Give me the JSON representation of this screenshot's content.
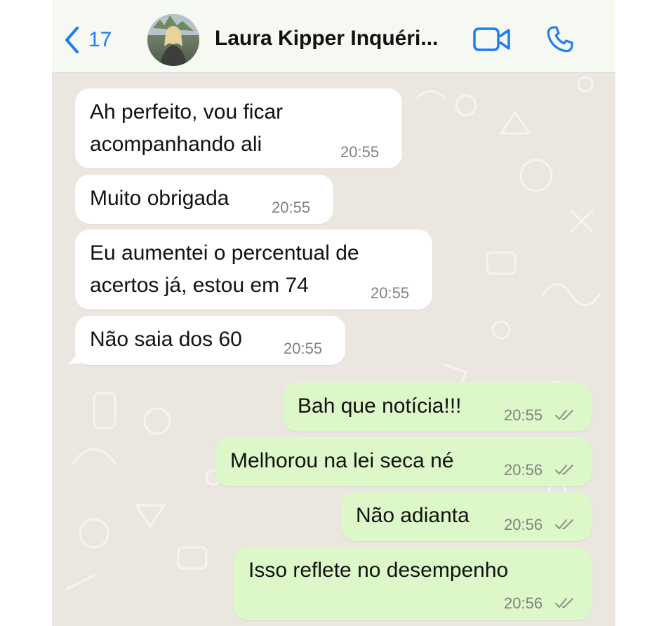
{
  "header": {
    "back_count": "17",
    "contact_name": "Laura Kipper Inquéri...",
    "icons": [
      "chevron-left-icon",
      "video-camera-icon",
      "phone-icon"
    ],
    "accent_color": "#1f7cf3"
  },
  "colors": {
    "incoming_bubble": "#ffffff",
    "outgoing_bubble": "#ddf8c8",
    "chat_background": "#ebe6e0",
    "header_background": "#f6f8f2"
  },
  "messages": [
    {
      "direction": "in",
      "lines": [
        "Ah perfeito, vou ficar",
        "acompanhando ali"
      ],
      "time": "20:55"
    },
    {
      "direction": "in",
      "lines": [
        "Muito obrigada"
      ],
      "time": "20:55"
    },
    {
      "direction": "in",
      "lines": [
        "Eu aumentei o percentual de",
        "acertos já, estou em 74"
      ],
      "time": "20:55"
    },
    {
      "direction": "in",
      "lines": [
        "Não saia dos 60"
      ],
      "time": "20:55"
    },
    {
      "direction": "out",
      "lines": [
        "Bah que notícia!!!"
      ],
      "time": "20:55",
      "status": "read-ticks"
    },
    {
      "direction": "out",
      "lines": [
        "Melhorou na lei seca né"
      ],
      "time": "20:56",
      "status": "read-ticks"
    },
    {
      "direction": "out",
      "lines": [
        "Não adianta"
      ],
      "time": "20:56",
      "status": "read-ticks"
    },
    {
      "direction": "out",
      "lines": [
        "Isso reflete no desempenho"
      ],
      "time": "20:56",
      "status": "read-ticks"
    }
  ]
}
